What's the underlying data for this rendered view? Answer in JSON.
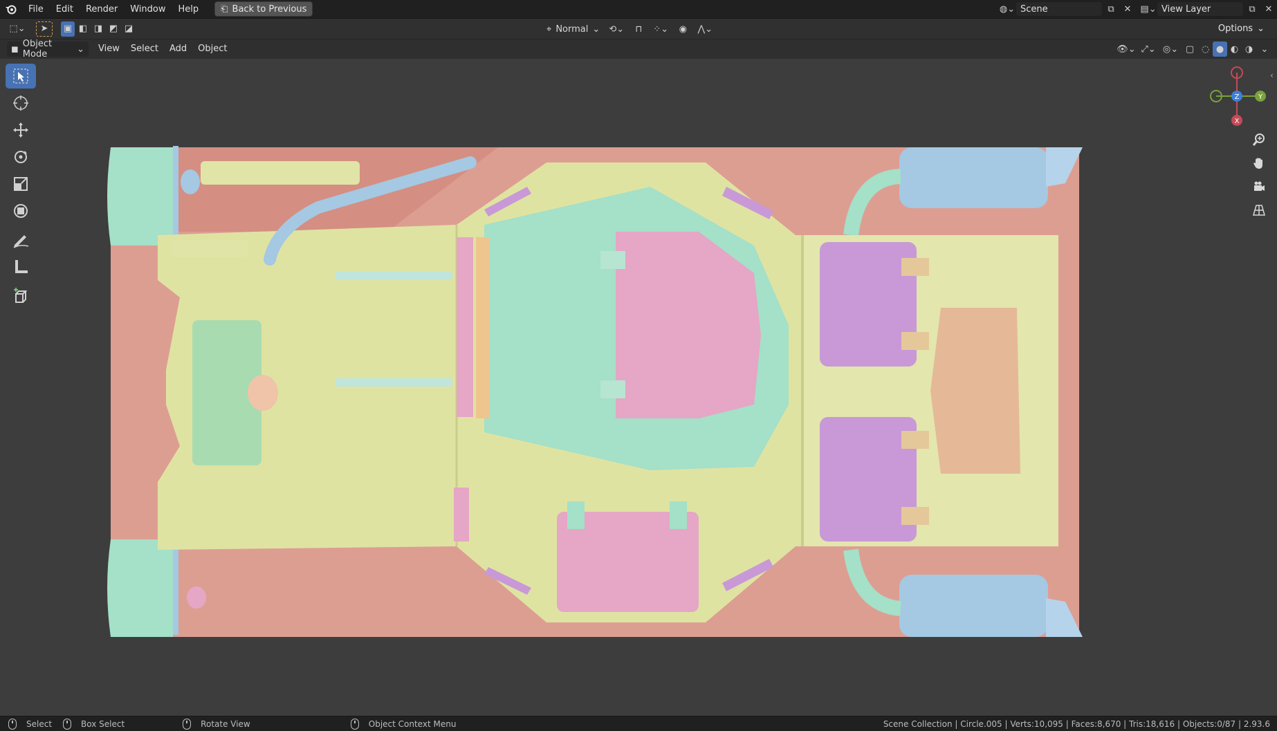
{
  "topbar": {
    "menus": [
      "File",
      "Edit",
      "Render",
      "Window",
      "Help"
    ],
    "back_button": "Back to Previous",
    "scene_label": "Scene",
    "view_layer_label": "View Layer"
  },
  "toolheader": {
    "transform_orientation": "Normal",
    "options_label": "Options"
  },
  "viewheader": {
    "mode": "Object Mode",
    "menus": [
      "View",
      "Select",
      "Add",
      "Object"
    ]
  },
  "gizmo": {
    "x_label": "X",
    "y_label": "Y",
    "z_label": "Z"
  },
  "toolbar": {
    "tools": [
      "select-box",
      "cursor",
      "move",
      "rotate",
      "scale",
      "transform",
      "annotate",
      "measure",
      "add-cube"
    ]
  },
  "statusbar": {
    "select": "Select",
    "box_select": "Box Select",
    "rotate_view": "Rotate View",
    "context_menu": "Object Context Menu",
    "stats": "Scene Collection | Circle.005 | Verts:10,095 | Faces:8,670 | Tris:18,616 | Objects:0/87 | 2.93.6"
  },
  "colors": {
    "hull": "#dfe3a2",
    "track": "#dd9e92",
    "cyan": "#a5e0c8",
    "pink": "#e6a6c5",
    "violet": "#c899d6",
    "blue": "#a5c8e3",
    "tan": "#e5b998",
    "accent": "#4772b3"
  }
}
